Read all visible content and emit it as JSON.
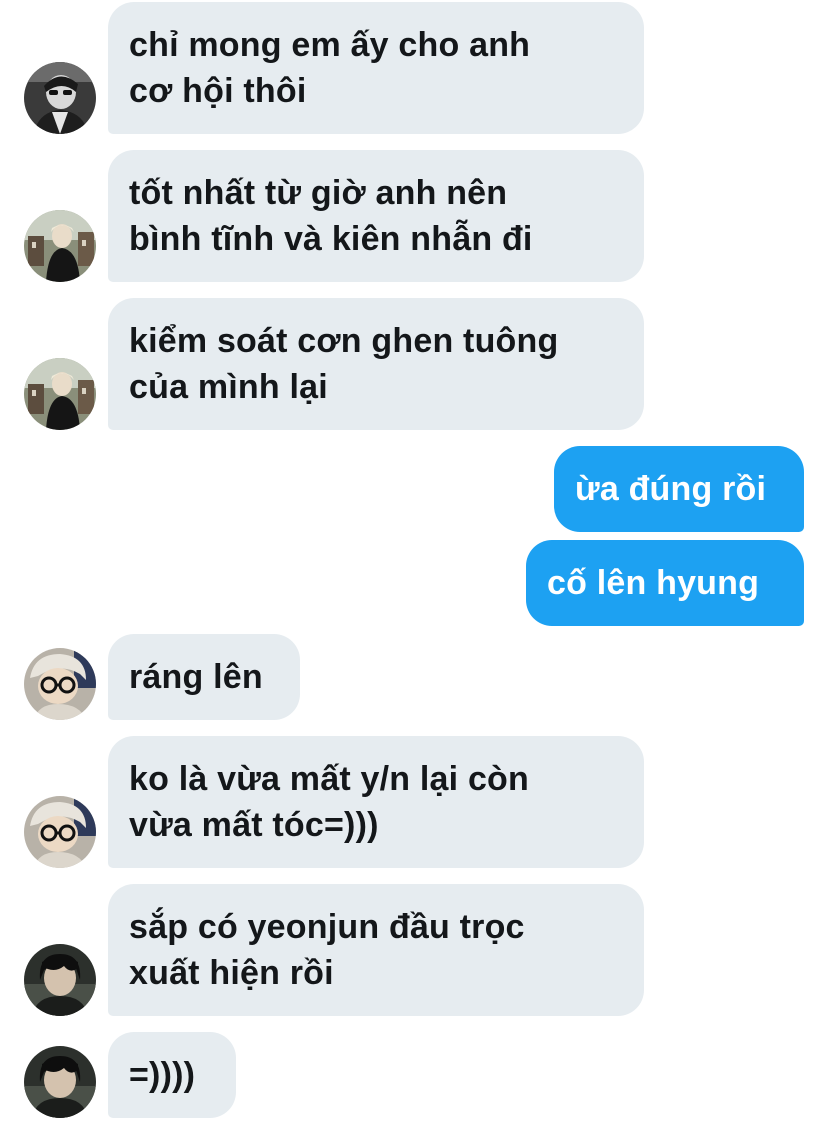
{
  "messages": [
    {
      "side": "in",
      "avatar": "avatar-1",
      "text": "chỉ mong em ấy cho anh\ncơ hội thôi"
    },
    {
      "side": "in",
      "avatar": "avatar-2",
      "text": "tốt nhất từ giờ anh nên\nbình tĩnh và kiên nhẫn đi"
    },
    {
      "side": "in",
      "avatar": "avatar-2",
      "text": "kiểm soát cơn ghen tuông\ncủa mình lại"
    },
    {
      "side": "out",
      "text": "ừa đúng rồi"
    },
    {
      "side": "out",
      "text": "cố lên hyung"
    },
    {
      "side": "in",
      "avatar": "avatar-3",
      "text": "ráng lên"
    },
    {
      "side": "in",
      "avatar": "avatar-3",
      "text": "ko là vừa mất y/n lại còn\nvừa mất tóc=)))"
    },
    {
      "side": "in",
      "avatar": "avatar-4",
      "text": "sắp có yeonjun đầu trọc\nxuất hiện rồi"
    },
    {
      "side": "in",
      "avatar": "avatar-4",
      "text": "=))))"
    }
  ],
  "colors": {
    "incoming_bubble": "#e6ecf0",
    "outgoing_bubble": "#1da1f2",
    "incoming_text": "#14171a",
    "outgoing_text": "#ffffff"
  }
}
